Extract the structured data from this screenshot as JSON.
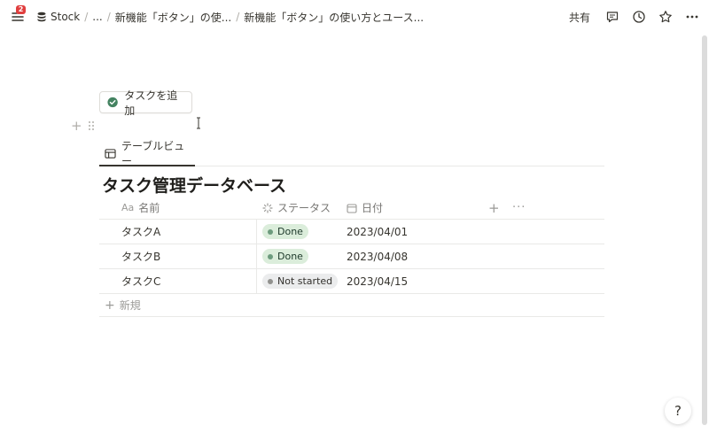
{
  "topbar": {
    "badge_count": "2",
    "breadcrumbs": {
      "root": "Stock",
      "ellipsis": "...",
      "parent": "新機能「ボタン」の使...",
      "current": "新機能「ボタン」の使い方とユース..."
    },
    "share_label": "共有",
    "icons": [
      "comment-icon",
      "history-icon",
      "star-icon",
      "more-icon"
    ]
  },
  "page": {
    "add_task_button": "タスクを追加",
    "view_tab": "テーブルビュー",
    "db_title": "タスク管理データベース"
  },
  "table": {
    "columns": {
      "name_prefix": "Aa",
      "name": "名前",
      "status": "ステータス",
      "date": "日付",
      "add": "+",
      "more": "···"
    },
    "rows": [
      {
        "name": "タスクA",
        "status": "Done",
        "date": "2023/04/01"
      },
      {
        "name": "タスクB",
        "status": "Done",
        "date": "2023/04/08"
      },
      {
        "name": "タスクC",
        "status": "Not started",
        "date": "2023/04/15"
      }
    ],
    "new_label": "新規"
  },
  "help": "?",
  "colors": {
    "done_bg": "#dbeddb",
    "not_started_bg": "#ebeced",
    "check_green": "#448361",
    "badge_red": "#e03e3e"
  }
}
